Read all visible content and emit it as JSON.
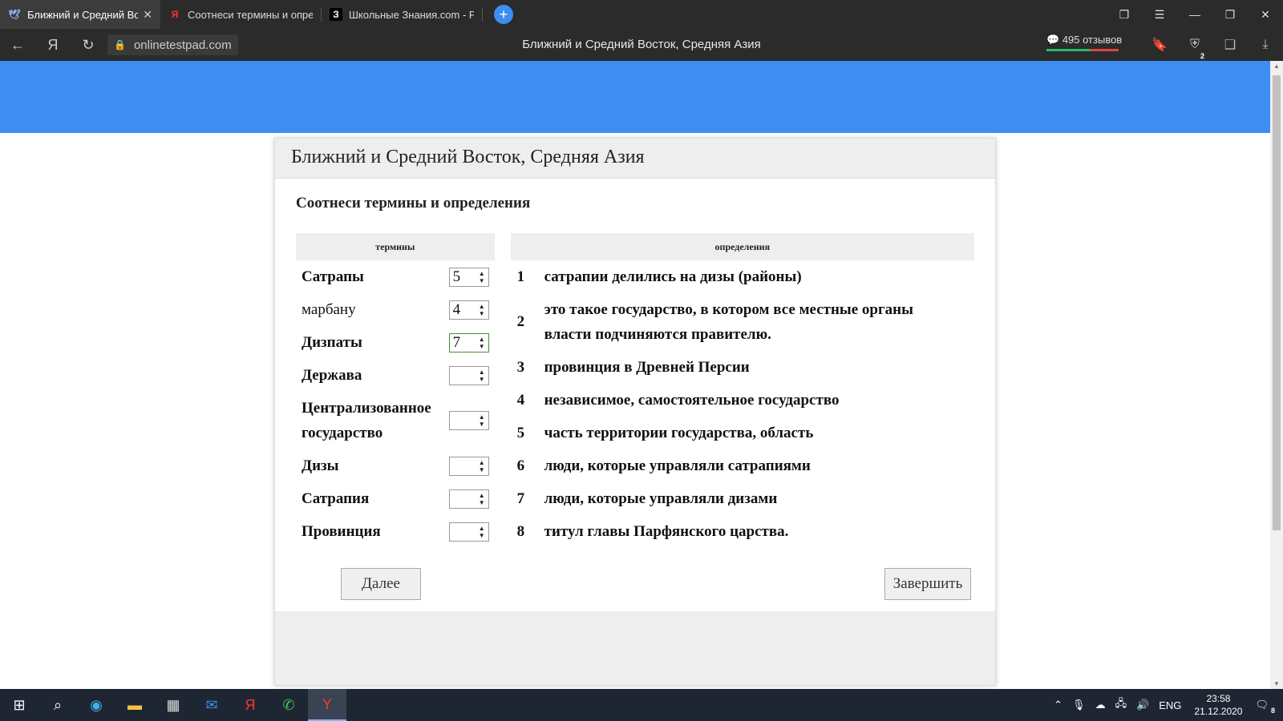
{
  "browser": {
    "tabs": [
      {
        "title": "Ближний и Средний Восток, Средняя Азия",
        "icon": "🕊",
        "active": true
      },
      {
        "title": "Соотнеси термины и определения",
        "icon": "Я",
        "active": false
      },
      {
        "title": "Школьные Знания.com - Р",
        "icon": "З",
        "active": false
      }
    ],
    "new_tab": "+",
    "url": "onlinetestpad.com",
    "page_title": "Ближний и Средний Восток, Средняя Азия",
    "reviews": "495 отзывов",
    "badge_count": "2"
  },
  "test": {
    "title": "Ближний и Средний Восток, Средняя Азия",
    "question": "Соотнеси термины и определения",
    "terms_header": "термины",
    "defs_header": "определения",
    "terms": [
      {
        "label": "Сатрапы",
        "value": "5"
      },
      {
        "label": "марбану",
        "value": "4"
      },
      {
        "label": "Дизпаты",
        "value": "7"
      },
      {
        "label": "Держава",
        "value": ""
      },
      {
        "label": "Централизованное государство",
        "value": ""
      },
      {
        "label": "Дизы",
        "value": ""
      },
      {
        "label": "Сатрапия",
        "value": ""
      },
      {
        "label": "Провинция",
        "value": ""
      }
    ],
    "definitions": [
      {
        "n": "1",
        "text": "сатрапии делились на дизы (районы)"
      },
      {
        "n": "2",
        "text": "это такое государство, в котором все местные органы власти подчиняются правителю."
      },
      {
        "n": "3",
        "text": "провинция в Древней Персии"
      },
      {
        "n": "4",
        "text": "независимое, самостоятельное государство"
      },
      {
        "n": "5",
        "text": "часть территории государства, область"
      },
      {
        "n": "6",
        "text": "люди, которые управляли сатрапиями"
      },
      {
        "n": "7",
        "text": "люди, которые управляли дизами"
      },
      {
        "n": "8",
        "text": "титул главы Парфянского царства."
      }
    ],
    "next_button": "Далее",
    "finish_button": "Завершить"
  },
  "taskbar": {
    "lang": "ENG",
    "time": "23:58",
    "date": "21.12.2020",
    "notif_count": "8"
  }
}
